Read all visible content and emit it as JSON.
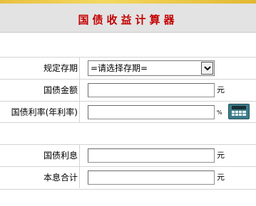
{
  "header": {
    "title": "国债收益计算器"
  },
  "form": {
    "period": {
      "label": "规定存期",
      "selected": "=请选择存期="
    },
    "amount": {
      "label": "国债金额",
      "value": "",
      "unit": "元"
    },
    "rate": {
      "label": "国债利率(年利率)",
      "value": "",
      "unit": "%"
    },
    "interest": {
      "label": "国债利息",
      "value": "",
      "unit": "元"
    },
    "total": {
      "label": "本息合计",
      "value": "",
      "unit": "元"
    }
  },
  "icons": {
    "calculate": "calculator-icon",
    "dropdown": "chevron-down-icon"
  },
  "colors": {
    "title": "#c40000",
    "header_bg": "#e3e3e3",
    "top_strip": "#e8c040"
  }
}
